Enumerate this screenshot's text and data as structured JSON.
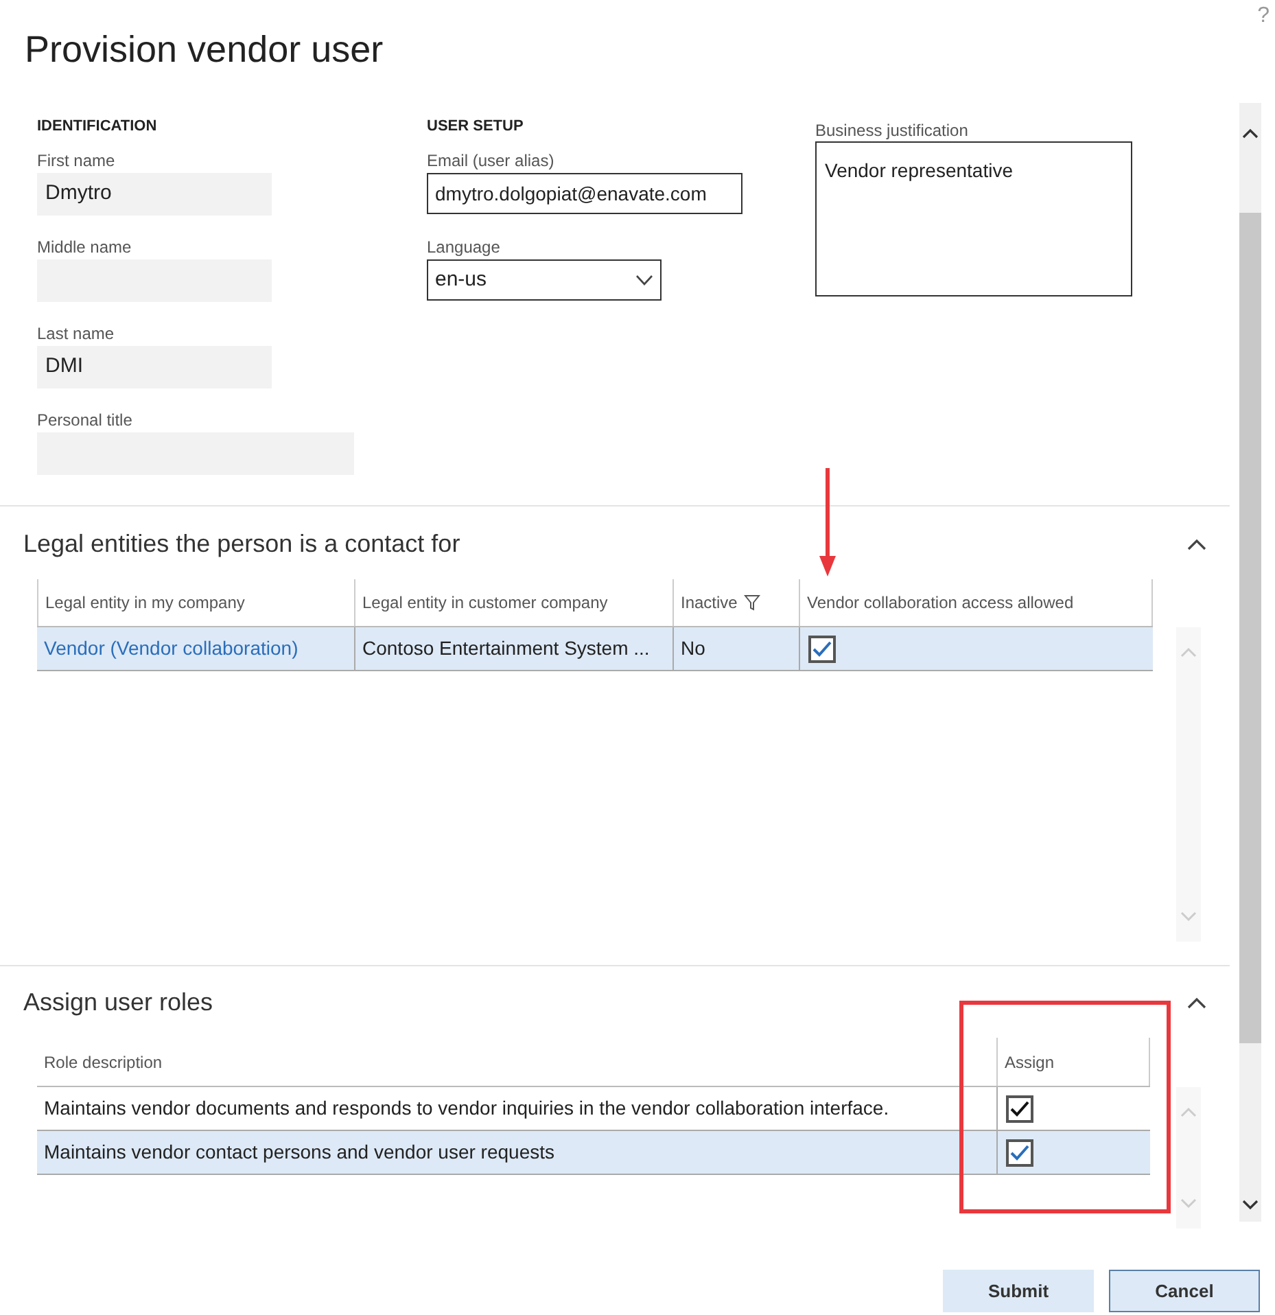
{
  "window": {
    "title": "Provision vendor user",
    "help": "?"
  },
  "identification": {
    "heading": "IDENTIFICATION",
    "fields": [
      {
        "label": "First name",
        "value": "Dmytro",
        "wide": false
      },
      {
        "label": "Middle name",
        "wide": false
      },
      {
        "label": "Last name",
        "value": "DMI",
        "wide": false
      },
      {
        "label": "Personal title",
        "wide": true
      }
    ]
  },
  "user_setup": {
    "heading": "USER SETUP",
    "email": {
      "label": "Email (user alias)",
      "value": "dmytro.dolgopiat@enavate.com"
    },
    "language": {
      "label": "Language",
      "value": "en-us"
    }
  },
  "business_justification": {
    "label": "Business justification",
    "value": "Vendor representative"
  },
  "legal_entities": {
    "title": "Legal entities the person is a contact for",
    "expanded": true,
    "columns": [
      {
        "label": "Legal entity in my company",
        "filtered": false
      },
      {
        "label": "Legal entity in customer company",
        "filtered": false
      },
      {
        "label": "Inactive",
        "filtered": true
      },
      {
        "label": "Vendor collaboration access allowed",
        "filtered": false
      }
    ],
    "rows": [
      {
        "entity": "Vendor (Vendor collaboration)",
        "customer_entity": "Contoso Entertainment System ...",
        "inactive": "No",
        "access_allowed": true,
        "selected": true
      }
    ]
  },
  "roles": {
    "title": "Assign user roles",
    "expanded": true,
    "columns": [
      "Role description",
      "Assign"
    ],
    "rows": [
      {
        "description": "Maintains vendor documents and responds to vendor inquiries in the vendor collaboration interface.",
        "assigned": true,
        "selected": false
      },
      {
        "description": "Maintains vendor contact persons and vendor user requests",
        "assigned": true,
        "selected": true
      }
    ]
  },
  "buttons": [
    {
      "label": "Submit",
      "kind": "primary"
    },
    {
      "label": "Cancel",
      "kind": "secondary"
    }
  ]
}
